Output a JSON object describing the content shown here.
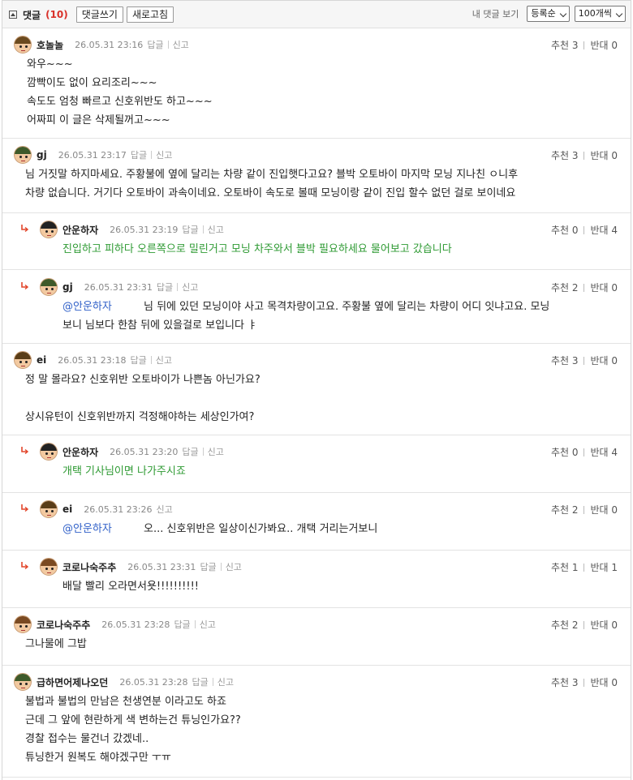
{
  "toolbar": {
    "title": "댓글",
    "count": "(10)",
    "write_label": "댓글쓰기",
    "refresh_label": "새로고침",
    "my_comments_label": "내 댓글 보기",
    "sort_value": "등록순",
    "per_page_value": "100개씩"
  },
  "comments": [
    {
      "author": "호놀놀",
      "time": "26.05.31 23:16",
      "reply_label": "답글",
      "report_label": "신고",
      "up_label": "추천 3",
      "down_label": "반대 0",
      "text": "와우~~~\n깜빡이도 없이 요리조리~~~\n속도도 엄청 빠르고 신호위반도 하고~~~\n어짜피 이 글은 삭제될꺼고~~~"
    },
    {
      "author": "gj",
      "time": "26.05.31 23:17",
      "reply_label": "답글",
      "report_label": "신고",
      "up_label": "추천 3",
      "down_label": "반대 0",
      "text": "님 거짓말 하지마세요. 주황불에 옆에 달리는 차량 같이 진입햇다고요? 블박 오토바이 마지막 모닝 지나친 ㅇ니후\n차량 없습니다. 거기다 오토바이 과속이네요. 오토바이 속도로 볼때 모닝이랑 같이 진입 할수 없던 걸로 보이네요"
    },
    {
      "author": "안운하자",
      "time": "26.05.31 23:19",
      "reply_label": "답글",
      "report_label": "신고",
      "up_label": "추천 0",
      "down_label": "반대 4",
      "text": "진입하고 피하다 오른쪽으로 밀린거고 모닝 차주와서 블박 필요하세요 물어보고 갔습니다"
    },
    {
      "author": "gj",
      "time": "26.05.31 23:31",
      "reply_label": "답글",
      "report_label": "신고",
      "up_label": "추천 2",
      "down_label": "반대 0",
      "mention": "@안운하자",
      "text": "님 뒤에 있던 모닝이야 사고 목격차량이고요. 주황불 옆에 달리는 차량이 어디 잇냐고요. 모닝\n보니 님보다 한참 뒤에 있을걸로 보입니다 ㅑ"
    },
    {
      "author": "ei",
      "time": "26.05.31 23:18",
      "reply_label": "답글",
      "report_label": "신고",
      "up_label": "추천 3",
      "down_label": "반대 0",
      "text": "정 말 몰라요? 신호위반 오토바이가 나쁜놈 아닌가요?\n\n상시유턴이 신호위반까지 걱정해야하는 세상인가여?"
    },
    {
      "author": "안운하자",
      "time": "26.05.31 23:20",
      "reply_label": "답글",
      "report_label": "신고",
      "up_label": "추천 0",
      "down_label": "반대 4",
      "text": "개택 기사님이면 나가주시죠"
    },
    {
      "author": "ei",
      "time": "26.05.31 23:26",
      "report_label": "신고",
      "up_label": "추천 2",
      "down_label": "반대 0",
      "mention": "@안운하자",
      "text": "오... 신호위반은 일상이신가봐요.. 개택 거리는거보니"
    },
    {
      "author": "코로나숙주추",
      "time": "26.05.31 23:31",
      "reply_label": "답글",
      "report_label": "신고",
      "up_label": "추천 1",
      "down_label": "반대 1",
      "text": "배달 빨리 오라면서욧!!!!!!!!!!"
    },
    {
      "author": "코로나숙주추",
      "time": "26.05.31 23:28",
      "reply_label": "답글",
      "report_label": "신고",
      "up_label": "추천 2",
      "down_label": "반대 0",
      "text": "그나물에 그밥"
    },
    {
      "author": "급하면어제나오던",
      "time": "26.05.31 23:28",
      "reply_label": "답글",
      "report_label": "신고",
      "up_label": "추천 3",
      "down_label": "반대 0",
      "text": "불법과 불법의 만남은 천생연분 이라고도 하죠\n근데 그 앞에 현란하게 색 변하는건 튜닝인가요??\n경찰 접수는 물건너 갔겠네..\n튜닝한거 원복도 해야겠구만 ㅜㅠ"
    }
  ],
  "colors": {
    "accent_red": "#d9312a",
    "reply_green": "#2e9a33",
    "mention_blue": "#3060c8",
    "reply_arrow": "#e2452a"
  }
}
